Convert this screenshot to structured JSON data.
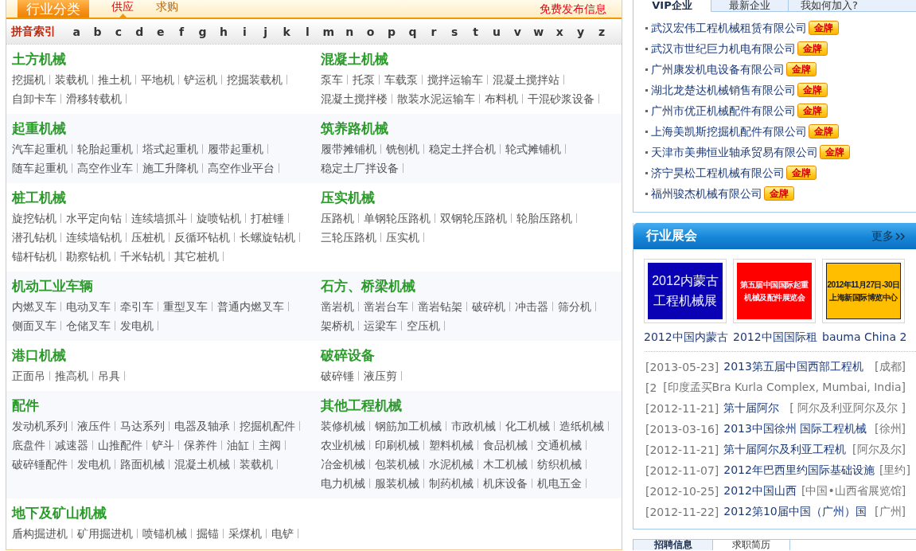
{
  "category_panel": {
    "title": "行业分类",
    "tabs": [
      {
        "label": "供应",
        "selected": true
      },
      {
        "label": "求购",
        "selected": false
      }
    ],
    "post_link": "免费发布信息",
    "index_label": "拼音索引",
    "letters": [
      "a",
      "b",
      "c",
      "d",
      "e",
      "f",
      "g",
      "h",
      "i",
      "j",
      "k",
      "l",
      "m",
      "n",
      "o",
      "p",
      "q",
      "r",
      "s",
      "t",
      "u",
      "v",
      "w",
      "x",
      "y",
      "z"
    ],
    "sections": [
      {
        "title": "土方机械",
        "items": [
          "挖掘机",
          "装载机",
          "推土机",
          "平地机",
          "铲运机",
          "挖掘装载机",
          "自卸卡车",
          "滑移转载机"
        ]
      },
      {
        "title": "混凝土机械",
        "items": [
          "泵车",
          "托泵",
          "车载泵",
          "搅拌运输车",
          "混凝土搅拌站",
          "混凝土搅拌楼",
          "散装水泥运输车",
          "布料机",
          "干混砂浆设备"
        ]
      },
      {
        "title": "起重机械",
        "items": [
          "汽车起重机",
          "轮胎起重机",
          "塔式起重机",
          "履带起重机",
          "随车起重机",
          "高空作业车",
          "施工升降机",
          "高空作业平台"
        ]
      },
      {
        "title": "筑养路机械",
        "items": [
          "履带摊铺机",
          "铣刨机",
          "稳定土拌合机",
          "轮式摊铺机",
          "稳定土厂拌设备"
        ]
      },
      {
        "title": "桩工机械",
        "items": [
          "旋挖钻机",
          "水平定向钻",
          "连续墙抓斗",
          "旋喷钻机",
          "打桩锤",
          "潜孔钻机",
          "连续墙钻机",
          "压桩机",
          "反循环钻机",
          "长螺旋钻机",
          "锚杆钻机",
          "勘察钻机",
          "千米钻机",
          "其它桩机"
        ]
      },
      {
        "title": "压实机械",
        "items": [
          "压路机",
          "单钢轮压路机",
          "双钢轮压路机",
          "轮胎压路机",
          "三轮压路机",
          "压实机"
        ]
      },
      {
        "title": "机动工业车辆",
        "items": [
          "内燃叉车",
          "电动叉车",
          "牵引车",
          "重型叉车",
          "普通内燃叉车",
          "侧面叉车",
          "仓储叉车",
          "发电机"
        ]
      },
      {
        "title": "石方、桥梁机械",
        "items": [
          "凿岩机",
          "凿岩台车",
          "凿岩钻架",
          "破碎机",
          "冲击器",
          "筛分机",
          "架桥机",
          "运梁车",
          "空压机"
        ]
      },
      {
        "title": "港口机械",
        "items": [
          "正面吊",
          "推高机",
          "吊具"
        ]
      },
      {
        "title": "破碎设备",
        "items": [
          "破碎锤",
          "液压剪"
        ]
      },
      {
        "title": "配件",
        "items": [
          "发动机系列",
          "液压件",
          "马达系列",
          "电器及轴承",
          "挖掘机配件",
          "底盘件",
          "减速器",
          "山推配件",
          "铲斗",
          "保养件",
          "油缸",
          "主阀",
          "破碎锤配件",
          "发电机",
          "路面机械",
          "混凝土机械",
          "装载机"
        ]
      },
      {
        "title": "其他工程机械",
        "items": [
          "装修机械",
          "钢筋加工机械",
          "市政机械",
          "化工机械",
          "造纸机械",
          "农业机械",
          "印刷机械",
          "塑料机械",
          "食品机械",
          "交通机械",
          "冶金机械",
          "包装机械",
          "水泥机械",
          "木工机械",
          "纺织机械",
          "电力机械",
          "服装机械",
          "制药机械",
          "机床设备",
          "机电五金"
        ]
      },
      {
        "title": "地下及矿山机械",
        "items": [
          "盾构掘进机",
          "矿用掘进机",
          "喷锚机械",
          "掘锚",
          "采煤机",
          "电铲"
        ]
      }
    ]
  },
  "company_panel": {
    "tabs": [
      {
        "label": "VIP企业",
        "selected": true
      },
      {
        "label": "最新企业",
        "selected": false
      },
      {
        "label": "我如何加入?",
        "selected": false
      }
    ],
    "companies": [
      {
        "name": "武汉宏伟工程机械租赁有限公司",
        "badge": "金牌"
      },
      {
        "name": "武汉市世纪巨力机电有限公司",
        "badge": "金牌"
      },
      {
        "name": "广州康发机电设备有限公司",
        "badge": "金牌"
      },
      {
        "name": "湖北龙楚达机械销售有限公司",
        "badge": "金牌"
      },
      {
        "name": "广州市优正机械配件有限公司",
        "badge": "金牌"
      },
      {
        "name": "上海美凯斯挖掘机配件有限公司",
        "badge": "金牌"
      },
      {
        "name": "天津市美弗恒业轴承贸易有限公司",
        "badge": "金牌"
      },
      {
        "name": "济宁昊松工程机械有限公司",
        "badge": "金牌"
      },
      {
        "name": "福州骏杰机械有限公司",
        "badge": "金牌"
      }
    ]
  },
  "exhibition_panel": {
    "title": "行业展会",
    "more": "更多",
    "banners": [
      {
        "lines": [
          "2012内蒙古",
          "工程机械展"
        ],
        "color": "#0a00b4",
        "caption": "2012中国内蒙古"
      },
      {
        "lines": [
          "第五届中国国际起重",
          "机械及配件展览会"
        ],
        "color": "#ff0000",
        "caption": "2012中国国际租"
      },
      {
        "lines": [
          "2012年11月27日-30日",
          "上海新国际博览中心"
        ],
        "color": "#ffbf00",
        "caption": "bauma China 2"
      }
    ],
    "events": [
      {
        "date": "[2013-05-23]",
        "title": "2013第五届中国西部工程机",
        "location": "[成都]"
      },
      {
        "date": "[2",
        "location": "[印度孟买Bra Kurla Complex, Mumbai, India]"
      },
      {
        "date": "[2012-11-21]",
        "title": "第十届阿尔",
        "location": "[ 阿尔及利亚阿尔及尔 ]"
      },
      {
        "date": "[2013-03-16]",
        "title": "2013中国徐州 国际工程机械",
        "location": "[徐州]"
      },
      {
        "date": "[2012-11-21]",
        "title": "第十届阿尔及利亚工程机",
        "location": "[阿尔及尔]"
      },
      {
        "date": "[2012-11-07]",
        "title": "2012年巴西里约国际基础设施",
        "location": "[里约]"
      },
      {
        "date": "[2012-10-25]",
        "title": "2012中国山西",
        "location": "[中国•山西省展览馆]"
      },
      {
        "date": "[2012-11-22]",
        "title": "2012第10届中国（广州）国",
        "location": "[广州]"
      }
    ]
  },
  "job_panel": {
    "tabs": [
      {
        "label": "招聘信息",
        "selected": true
      },
      {
        "label": "求职简历",
        "selected": false
      }
    ]
  }
}
